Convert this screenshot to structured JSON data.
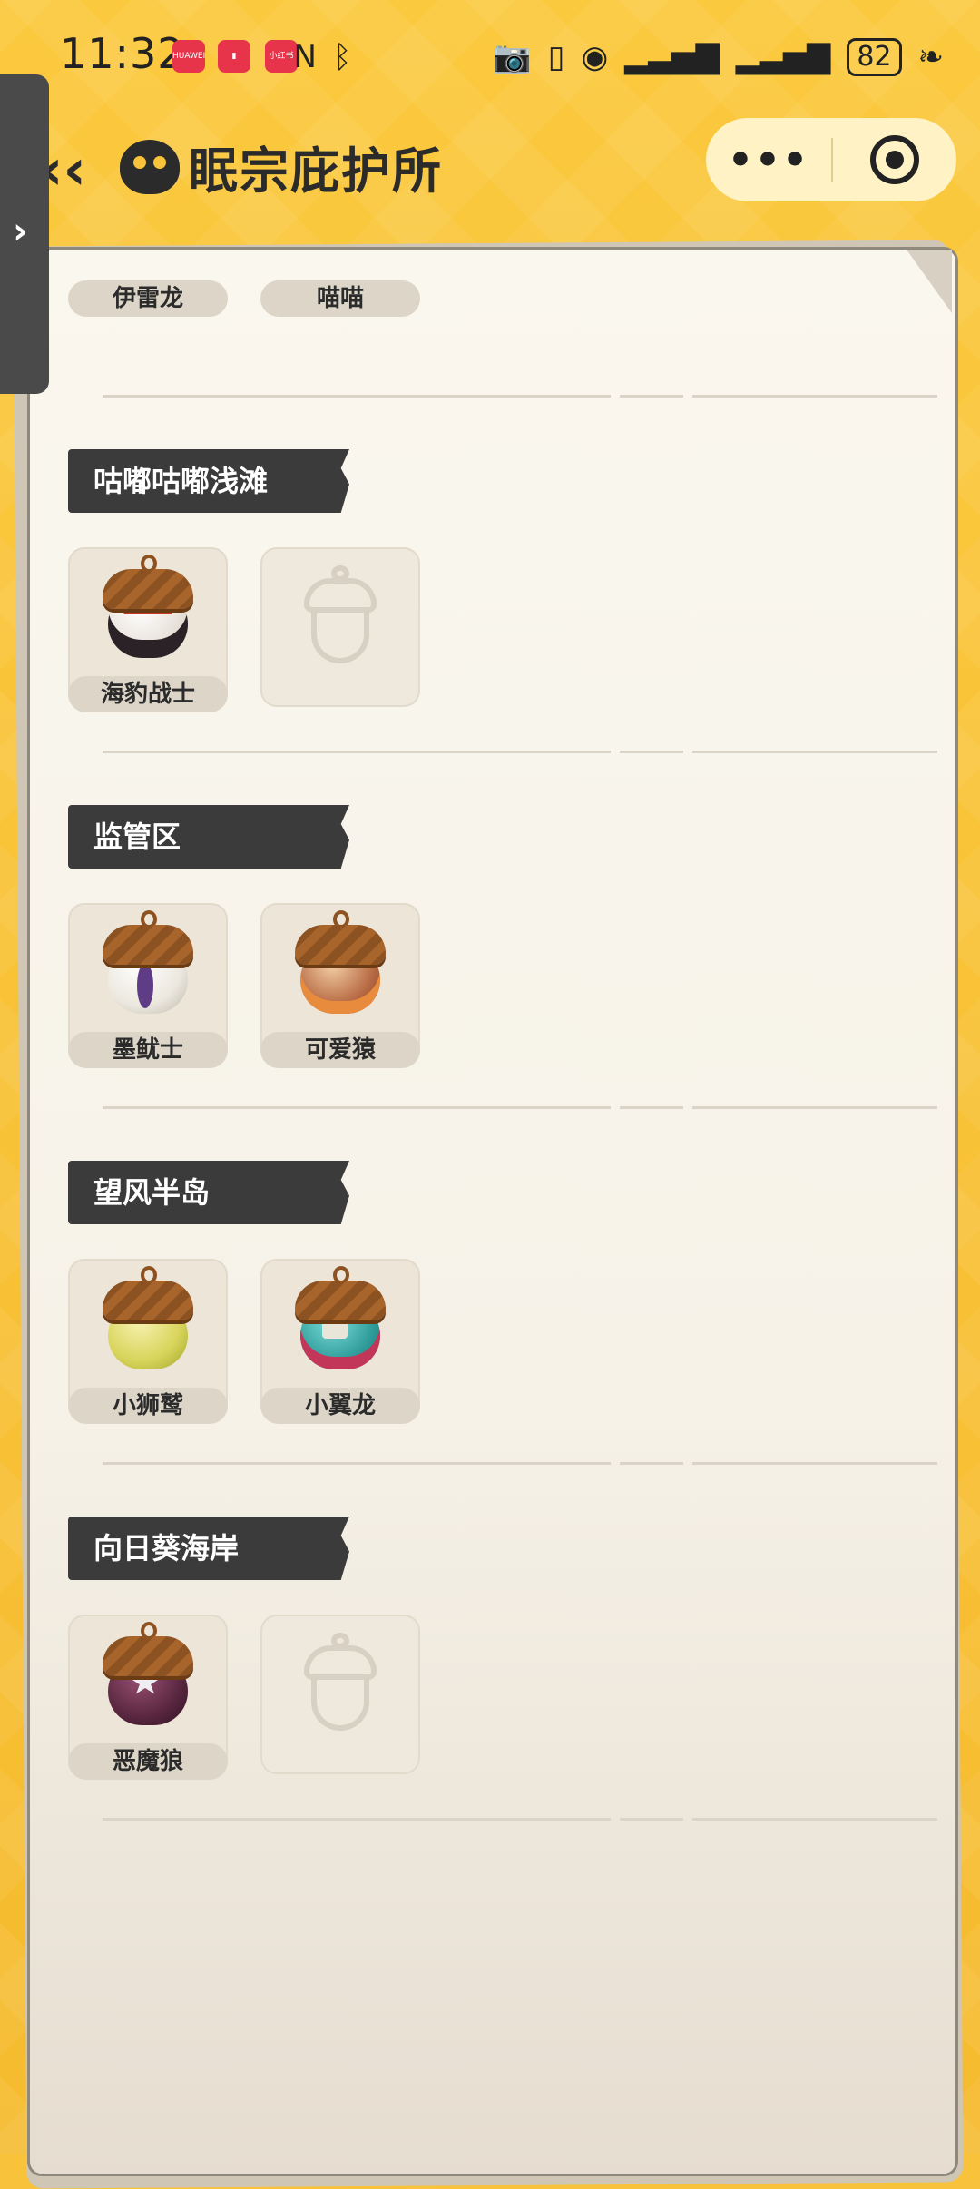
{
  "status_bar": {
    "time": "11:32",
    "badges": [
      "HUAWEI",
      "",
      "小红书"
    ],
    "battery": "82"
  },
  "header": {
    "back_icon": "double-chevron-left-icon",
    "title": "眠宗庇护所",
    "capsule_more": "•••",
    "capsule_close_icon": "target-icon"
  },
  "side_handle": {
    "icon": "chevron-right-icon",
    "label": "›"
  },
  "top_partial_cards": [
    "伊雷龙",
    "喵喵"
  ],
  "sections": [
    {
      "name": "咕嘟咕嘟浅滩",
      "items": [
        {
          "name": "海豹战士",
          "filled": true,
          "color": "#e9e3dc",
          "accent": "#c23a2f"
        },
        {
          "name": "",
          "filled": false
        }
      ]
    },
    {
      "name": "监管区",
      "items": [
        {
          "name": "墨鱿士",
          "filled": true,
          "color": "#ece8df",
          "accent": "#5f3c86"
        },
        {
          "name": "可爱猿",
          "filled": true,
          "color": "#b76a43",
          "accent": "#e88b3c"
        }
      ]
    },
    {
      "name": "望风半岛",
      "items": [
        {
          "name": "小狮鹫",
          "filled": true,
          "color": "#d8d45a",
          "accent": "#9ea32b"
        },
        {
          "name": "小翼龙",
          "filled": true,
          "color": "#2f9c9a",
          "accent": "#e9e5d8"
        }
      ]
    },
    {
      "name": "向日葵海岸",
      "items": [
        {
          "name": "恶魔狼",
          "filled": true,
          "color": "#5a2740",
          "accent": "#f1eef2"
        },
        {
          "name": "",
          "filled": false
        }
      ]
    }
  ]
}
